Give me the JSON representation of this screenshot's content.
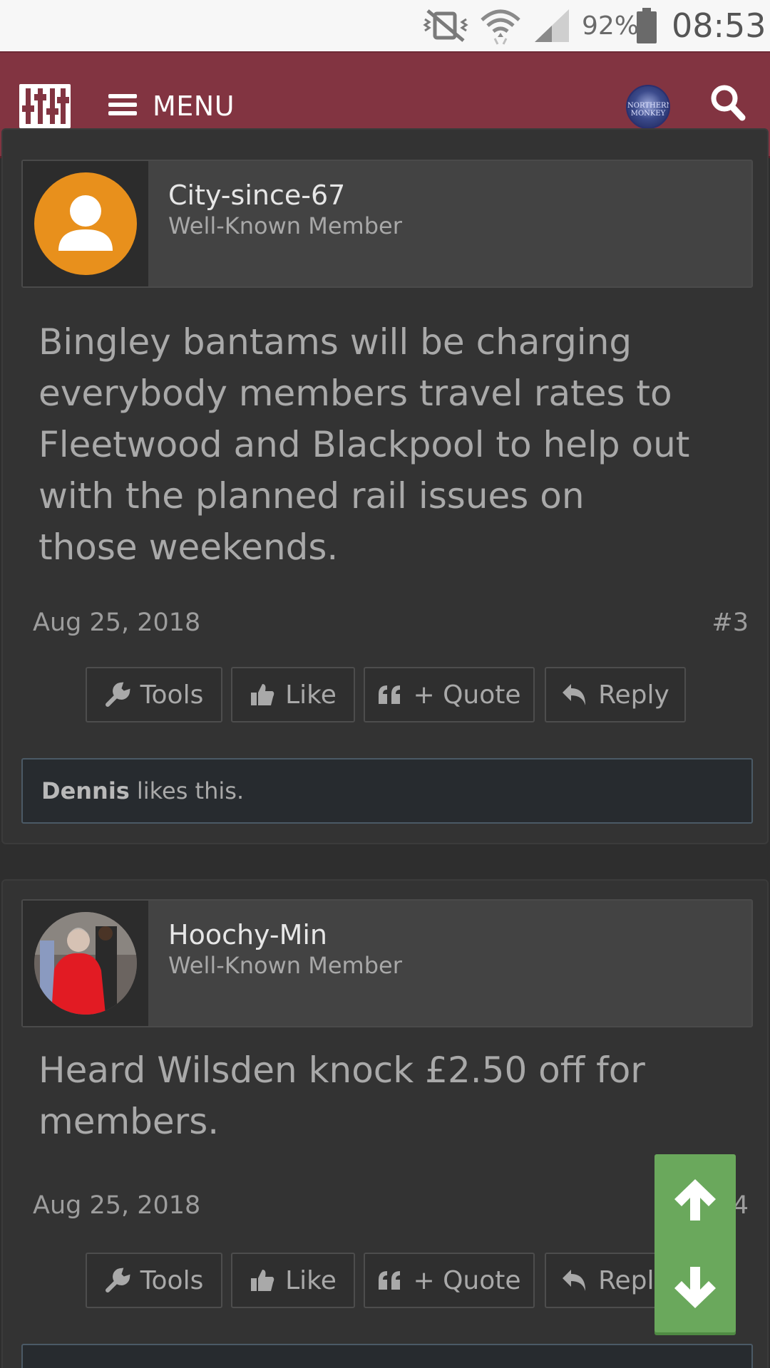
{
  "status_bar": {
    "battery_percent": "92%",
    "time": "08:53",
    "icons": [
      "vibrate-off-icon",
      "wifi-icon",
      "signal-icon",
      "battery-icon"
    ]
  },
  "header": {
    "menu_label": "MENU",
    "logo_icon": "sliders-logo-icon",
    "search_icon": "search-icon",
    "avatar_text": "NORTHERN MONKEY",
    "colors": {
      "background": "#823441",
      "text": "#ffffff"
    }
  },
  "posts": [
    {
      "username": "City-since-67",
      "user_title": "Well-Known Member",
      "message": "Bingley bantams will be charging everybody members travel rates to Fleetwood and Blackpool to help out with the planned rail issues on those weekends.",
      "date": "Aug 25, 2018",
      "post_number": "#3",
      "likes": {
        "user": "Dennis",
        "text": "likes this."
      }
    },
    {
      "username": "Hoochy-Min",
      "user_title": "Well-Known Member",
      "message": "Heard Wilsden knock £2.50 off for members.",
      "date": "Aug 25, 2018",
      "post_number": "#4"
    }
  ],
  "actions": {
    "tools": "Tools",
    "like": "Like",
    "quote": "+ Quote",
    "reply": "Reply"
  },
  "scroll_widget": {
    "up_icon": "arrow-up-icon",
    "down_icon": "arrow-down-icon",
    "color": "#6aa85c"
  }
}
